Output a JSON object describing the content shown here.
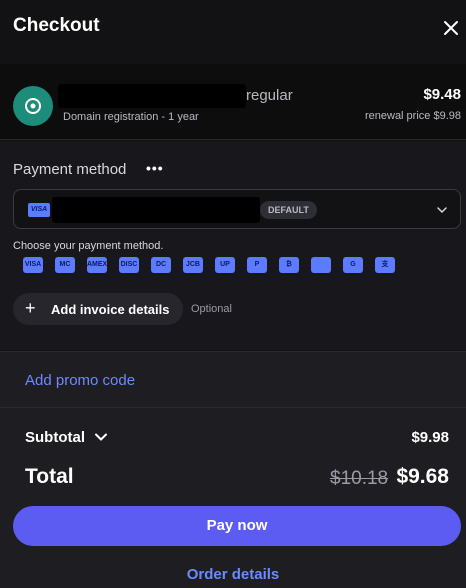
{
  "header": {
    "title": "Checkout"
  },
  "product": {
    "name_suffix": "regular",
    "subtitle": "Domain registration - 1 year",
    "price": "$9.48",
    "renewal": "renewal price $9.98"
  },
  "payment": {
    "label": "Payment method",
    "menu_glyph": "•••",
    "selected_card_brand": "VISA",
    "default_badge": "DEFAULT",
    "choose_text": "Choose your payment method.",
    "methods": [
      "VISA",
      "MC",
      "AMEX",
      "DISC",
      "DC",
      "JCB",
      "UP",
      "P",
      "₿",
      "",
      "G",
      "支"
    ],
    "invoice_label": "Add invoice details",
    "invoice_plus": "+",
    "optional_label": "Optional"
  },
  "promo": {
    "label": "Add promo code"
  },
  "summary": {
    "subtotal_label": "Subtotal",
    "subtotal_value": "$9.98",
    "total_label": "Total",
    "total_old": "$10.18",
    "total_value": "$9.68",
    "pay_label": "Pay now",
    "order_details_label": "Order details"
  },
  "colors": {
    "accent": "#5c5cf2",
    "link": "#6c8aff",
    "product_icon": "#1d8c7a",
    "card_badge": "#5c7cff"
  }
}
